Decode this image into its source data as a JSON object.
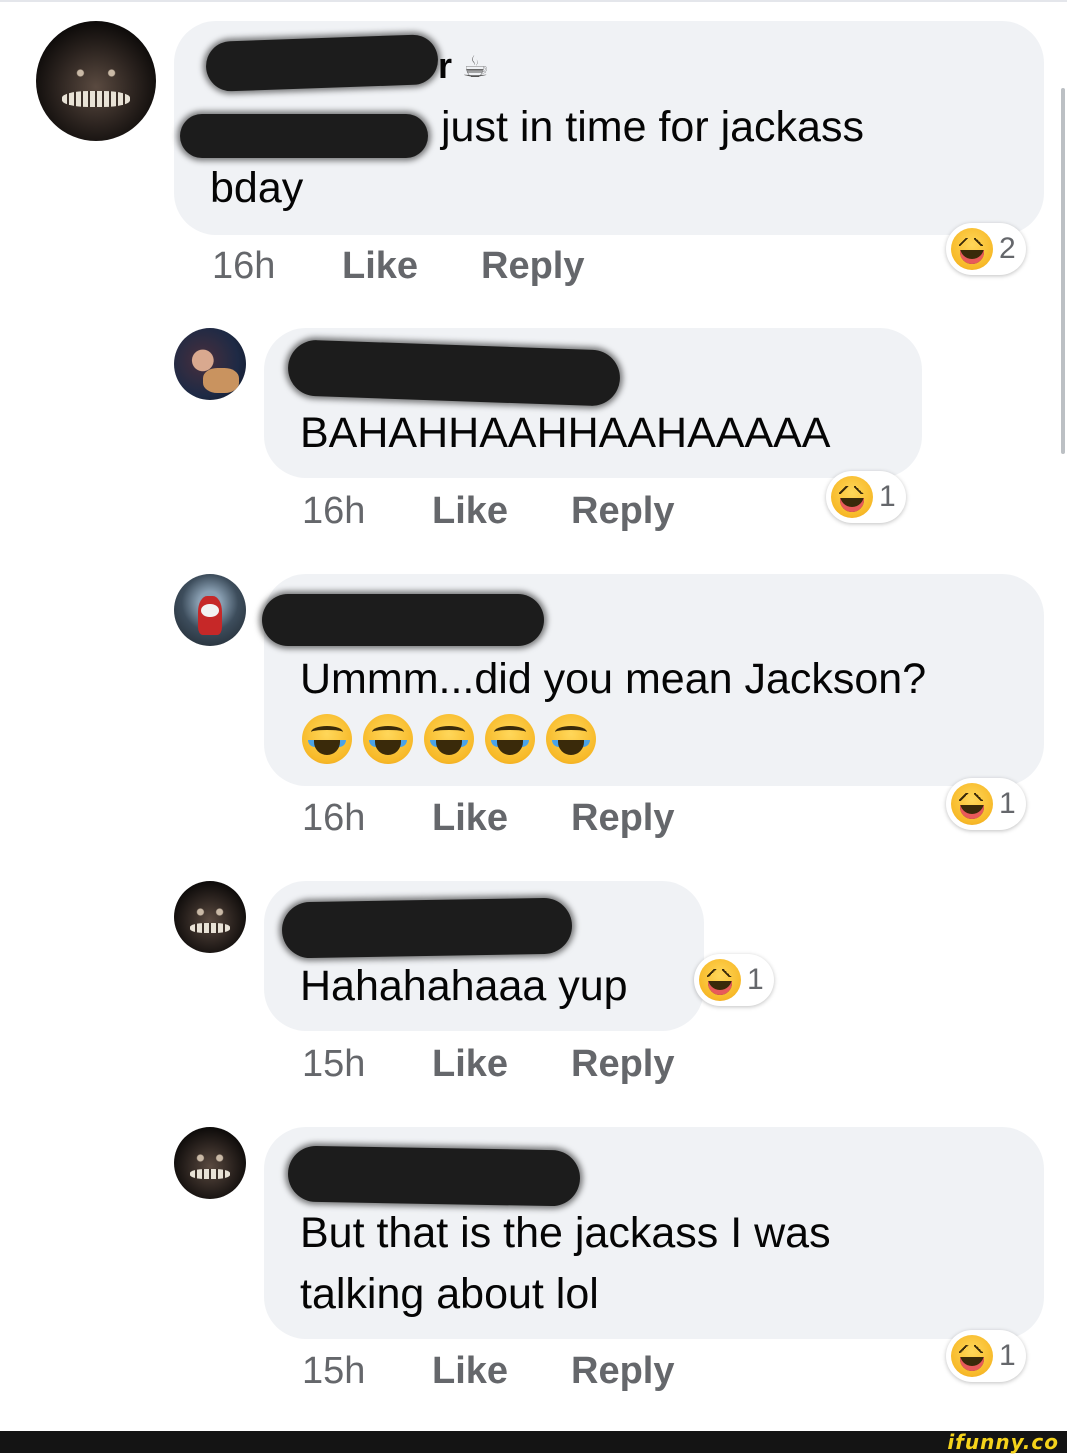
{
  "comments": [
    {
      "text_line1": "just in time for jackass",
      "text_line2": "bday",
      "time": "16h",
      "like": "Like",
      "reply": "Reply",
      "reaction_count": "2",
      "name_suffix": "r"
    },
    {
      "text": "BAHAHHAAHHAAHAAAAA",
      "time": "16h",
      "like": "Like",
      "reply": "Reply",
      "reaction_count": "1"
    },
    {
      "text": "Ummm...did you mean Jackson?",
      "emoji_row": [
        "crying-laughing",
        "crying-laughing",
        "crying-laughing",
        "crying-laughing",
        "crying-laughing"
      ],
      "time": "16h",
      "like": "Like",
      "reply": "Reply",
      "reaction_count": "1"
    },
    {
      "text": "Hahahahaaa yup",
      "time": "15h",
      "like": "Like",
      "reply": "Reply",
      "reaction_count": "1"
    },
    {
      "text_line1": "But that is the jackass I was",
      "text_line2": "talking about lol",
      "time": "15h",
      "like": "Like",
      "reply": "Reply",
      "reaction_count": "1"
    }
  ],
  "icons": {
    "reaction": "laughing-face-icon",
    "coffee": "coffee-icon"
  },
  "colors": {
    "bubble": "#f0f2f5",
    "meta_text": "#65676b",
    "redaction": "#1c1c1c",
    "watermark": "#f5d31b"
  },
  "watermark": "ifunny.co"
}
